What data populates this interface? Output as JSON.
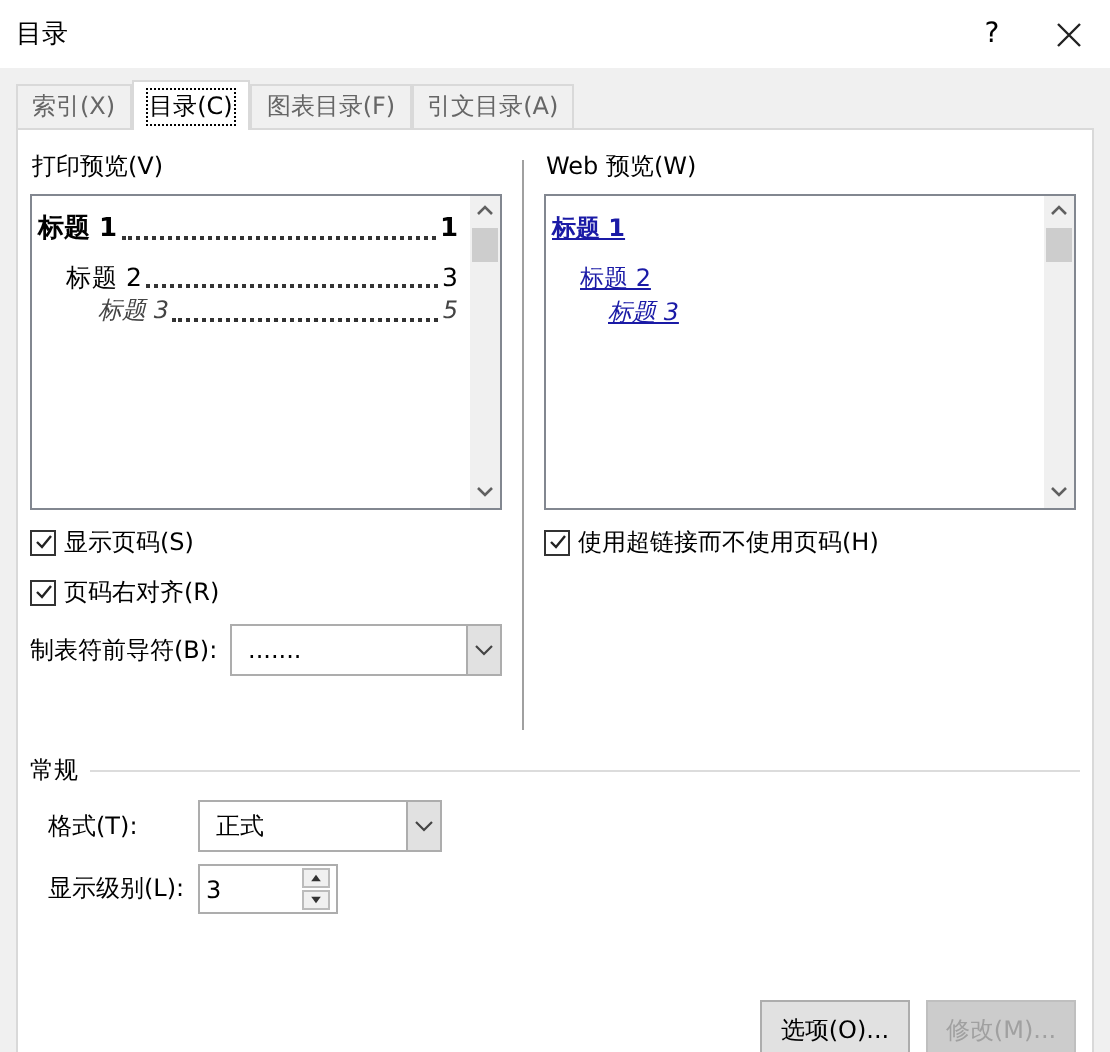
{
  "window": {
    "title": "目录",
    "help": "?"
  },
  "tabs": [
    {
      "label": "索引(X)",
      "selected": false
    },
    {
      "label": "目录(C)",
      "selected": true
    },
    {
      "label": "图表目录(F)",
      "selected": false
    },
    {
      "label": "引文目录(A)",
      "selected": false
    }
  ],
  "print_preview": {
    "label": "打印预览(V)",
    "entries": [
      {
        "text": "标题 1",
        "page": "1",
        "children": [
          {
            "text": "标题 2",
            "page": "3",
            "children": [
              {
                "text": "标题 3",
                "page": "5"
              }
            ]
          }
        ]
      }
    ]
  },
  "web_preview": {
    "label": "Web 预览(W)",
    "entries": [
      {
        "text": "标题 1",
        "children": [
          {
            "text": "标题 2",
            "children": [
              {
                "text": "标题 3"
              }
            ]
          }
        ]
      }
    ]
  },
  "options_left": [
    {
      "label": "显示页码(S)",
      "checked": true
    },
    {
      "label": "页码右对齐(R)",
      "checked": true
    }
  ],
  "options_right": [
    {
      "label": "使用超链接而不使用页码(H)",
      "checked": true
    }
  ],
  "tab_leader": {
    "label": "制表符前导符(B):",
    "value": "......."
  },
  "general": {
    "title": "常规",
    "format": {
      "label": "格式(T):",
      "value": "正式"
    },
    "levels": {
      "label": "显示级别(L):",
      "value": "3"
    }
  },
  "buttons": [
    {
      "label": "选项(O)...",
      "disabled": false
    },
    {
      "label": "修改(M)...",
      "disabled": true
    }
  ]
}
